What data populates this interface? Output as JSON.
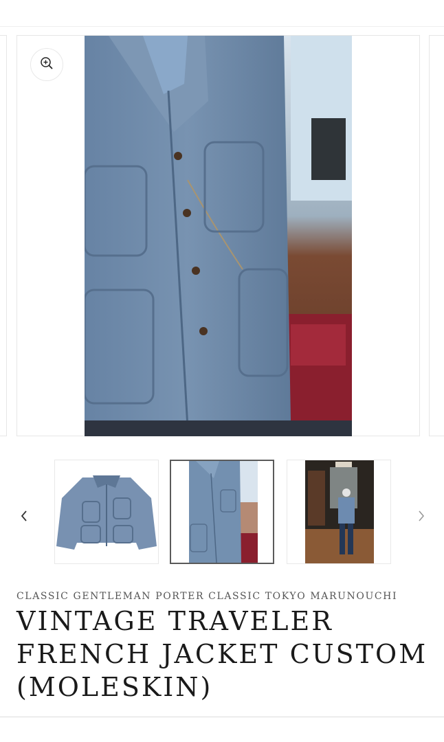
{
  "product": {
    "vendor": "CLASSIC GENTLEMAN PORTER CLASSIC TOKYO MARUNOUCHI",
    "title_lines": [
      "VINTAGE TRAVELER",
      "FRENCH JACKET CUSTOM",
      "(MOLESKIN)"
    ]
  },
  "gallery": {
    "active_index": 1,
    "thumbnails": [
      {
        "image": "jacket-flat-lay"
      },
      {
        "image": "jacket-worn-closeup"
      },
      {
        "image": "full-body-outfit-shop"
      }
    ]
  },
  "icons": {
    "zoom": "zoom-in-icon",
    "prev": "chevron-left-icon",
    "next": "chevron-right-icon"
  },
  "colors": {
    "jacket_blue": "#6f89a8",
    "text_dark": "#1a1a1a",
    "text_muted": "#555555",
    "active_border": "#5a5a5a"
  }
}
